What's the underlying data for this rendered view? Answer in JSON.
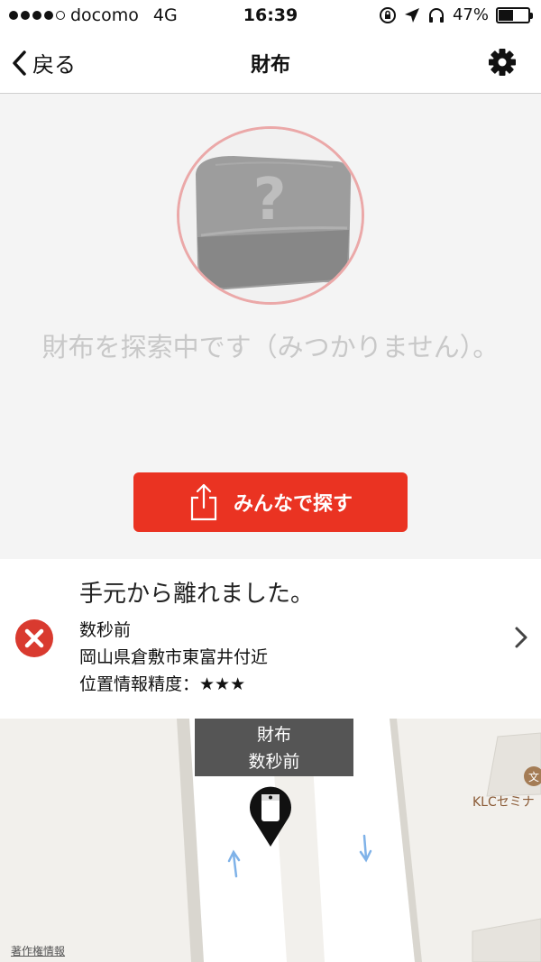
{
  "status_bar": {
    "carrier": "docomo",
    "network": "4G",
    "time": "16:39",
    "battery": "47%",
    "battery_level": 0.47
  },
  "nav": {
    "back_label": "戻る",
    "title": "財布"
  },
  "hero": {
    "message": "財布を探索中です（みつかりません）。",
    "share_label": "みんなで探す"
  },
  "status": {
    "heading": "手元から離れました。",
    "time": "数秒前",
    "place": "岡山県倉敷市東富井付近",
    "accuracy_label": "位置情報精度：",
    "accuracy_stars": "★★★"
  },
  "map": {
    "label_name": "財布",
    "label_time": "数秒前",
    "poi_name": "KLCセミナ",
    "copyright": "著作権情報"
  },
  "colors": {
    "accent_red": "#ea3322",
    "photo_border": "#eba8a8"
  }
}
